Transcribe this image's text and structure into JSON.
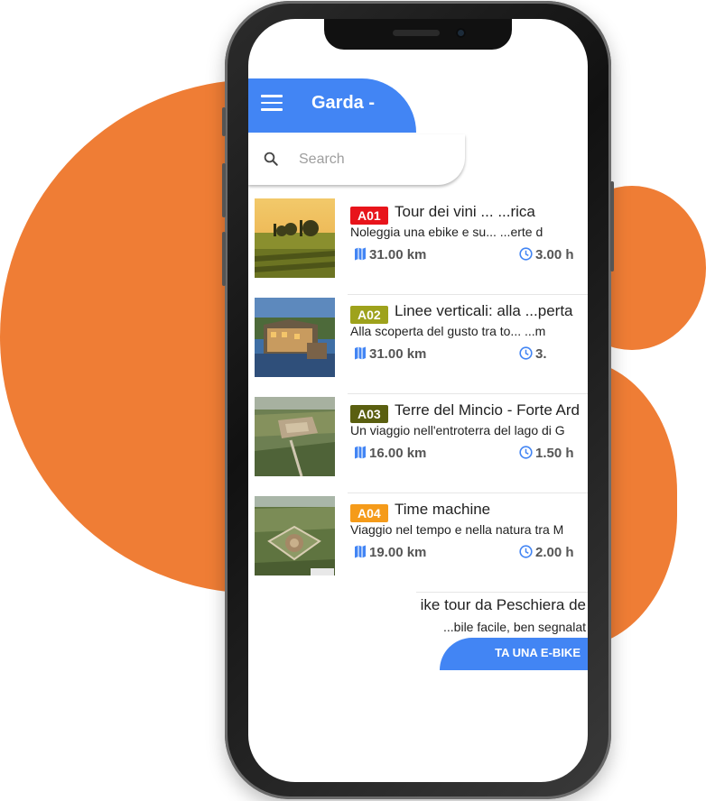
{
  "app": {
    "title": "Garda - "
  },
  "search": {
    "placeholder": "Search"
  },
  "tours": [
    {
      "code": "A01",
      "code_color": "#e8141b",
      "title": "Tour dei vini ... ...rica",
      "description": "Noleggia una ebike e su... ...erte d",
      "distance": "31.00 km",
      "duration": "3.00 h"
    },
    {
      "code": "A02",
      "code_color": "#9ea21c",
      "title": "Linee verticali: alla ...perta",
      "description": "Alla scoperta del gusto tra to... ...m",
      "distance": "31.00 km",
      "duration": "3."
    },
    {
      "code": "A03",
      "code_color": "#5a5f10",
      "title": "Terre del Mincio - Forte Ard",
      "description": "Un viaggio nell'entroterra del lago di G",
      "distance": "16.00 km",
      "duration": "1.50 h"
    },
    {
      "code": "A04",
      "code_color": "#f59b1a",
      "title": "Time machine",
      "description": "Viaggio nel tempo e nella natura tra M",
      "distance": "19.00 km",
      "duration": "2.00 h"
    }
  ],
  "partial_tour": {
    "title": "ike tour da Peschiera de",
    "description": "...bile facile, ben segnalat"
  },
  "cta": {
    "label": "TA UNA E-BIKE"
  },
  "colors": {
    "primary": "#4285f4",
    "accent_orange": "#ef7d35"
  },
  "icons": {
    "menu": "menu-icon",
    "search": "search-icon",
    "map": "map-icon",
    "clock": "clock-icon"
  }
}
